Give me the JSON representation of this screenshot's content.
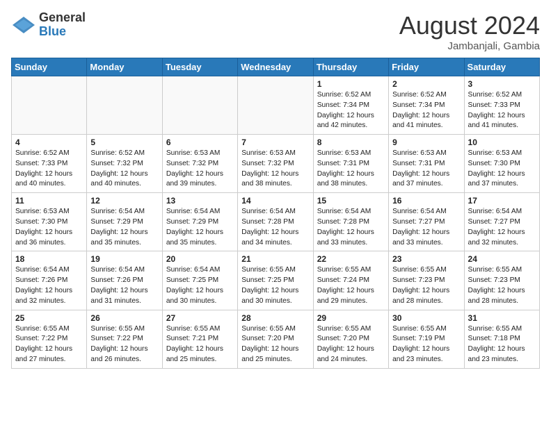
{
  "header": {
    "logo_general": "General",
    "logo_blue": "Blue",
    "title": "August 2024",
    "location": "Jambanjali, Gambia"
  },
  "days_of_week": [
    "Sunday",
    "Monday",
    "Tuesday",
    "Wednesday",
    "Thursday",
    "Friday",
    "Saturday"
  ],
  "weeks": [
    [
      {
        "day": "",
        "info": ""
      },
      {
        "day": "",
        "info": ""
      },
      {
        "day": "",
        "info": ""
      },
      {
        "day": "",
        "info": ""
      },
      {
        "day": "1",
        "info": "Sunrise: 6:52 AM\nSunset: 7:34 PM\nDaylight: 12 hours\nand 42 minutes."
      },
      {
        "day": "2",
        "info": "Sunrise: 6:52 AM\nSunset: 7:34 PM\nDaylight: 12 hours\nand 41 minutes."
      },
      {
        "day": "3",
        "info": "Sunrise: 6:52 AM\nSunset: 7:33 PM\nDaylight: 12 hours\nand 41 minutes."
      }
    ],
    [
      {
        "day": "4",
        "info": "Sunrise: 6:52 AM\nSunset: 7:33 PM\nDaylight: 12 hours\nand 40 minutes."
      },
      {
        "day": "5",
        "info": "Sunrise: 6:52 AM\nSunset: 7:32 PM\nDaylight: 12 hours\nand 40 minutes."
      },
      {
        "day": "6",
        "info": "Sunrise: 6:53 AM\nSunset: 7:32 PM\nDaylight: 12 hours\nand 39 minutes."
      },
      {
        "day": "7",
        "info": "Sunrise: 6:53 AM\nSunset: 7:32 PM\nDaylight: 12 hours\nand 38 minutes."
      },
      {
        "day": "8",
        "info": "Sunrise: 6:53 AM\nSunset: 7:31 PM\nDaylight: 12 hours\nand 38 minutes."
      },
      {
        "day": "9",
        "info": "Sunrise: 6:53 AM\nSunset: 7:31 PM\nDaylight: 12 hours\nand 37 minutes."
      },
      {
        "day": "10",
        "info": "Sunrise: 6:53 AM\nSunset: 7:30 PM\nDaylight: 12 hours\nand 37 minutes."
      }
    ],
    [
      {
        "day": "11",
        "info": "Sunrise: 6:53 AM\nSunset: 7:30 PM\nDaylight: 12 hours\nand 36 minutes."
      },
      {
        "day": "12",
        "info": "Sunrise: 6:54 AM\nSunset: 7:29 PM\nDaylight: 12 hours\nand 35 minutes."
      },
      {
        "day": "13",
        "info": "Sunrise: 6:54 AM\nSunset: 7:29 PM\nDaylight: 12 hours\nand 35 minutes."
      },
      {
        "day": "14",
        "info": "Sunrise: 6:54 AM\nSunset: 7:28 PM\nDaylight: 12 hours\nand 34 minutes."
      },
      {
        "day": "15",
        "info": "Sunrise: 6:54 AM\nSunset: 7:28 PM\nDaylight: 12 hours\nand 33 minutes."
      },
      {
        "day": "16",
        "info": "Sunrise: 6:54 AM\nSunset: 7:27 PM\nDaylight: 12 hours\nand 33 minutes."
      },
      {
        "day": "17",
        "info": "Sunrise: 6:54 AM\nSunset: 7:27 PM\nDaylight: 12 hours\nand 32 minutes."
      }
    ],
    [
      {
        "day": "18",
        "info": "Sunrise: 6:54 AM\nSunset: 7:26 PM\nDaylight: 12 hours\nand 32 minutes."
      },
      {
        "day": "19",
        "info": "Sunrise: 6:54 AM\nSunset: 7:26 PM\nDaylight: 12 hours\nand 31 minutes."
      },
      {
        "day": "20",
        "info": "Sunrise: 6:54 AM\nSunset: 7:25 PM\nDaylight: 12 hours\nand 30 minutes."
      },
      {
        "day": "21",
        "info": "Sunrise: 6:55 AM\nSunset: 7:25 PM\nDaylight: 12 hours\nand 30 minutes."
      },
      {
        "day": "22",
        "info": "Sunrise: 6:55 AM\nSunset: 7:24 PM\nDaylight: 12 hours\nand 29 minutes."
      },
      {
        "day": "23",
        "info": "Sunrise: 6:55 AM\nSunset: 7:23 PM\nDaylight: 12 hours\nand 28 minutes."
      },
      {
        "day": "24",
        "info": "Sunrise: 6:55 AM\nSunset: 7:23 PM\nDaylight: 12 hours\nand 28 minutes."
      }
    ],
    [
      {
        "day": "25",
        "info": "Sunrise: 6:55 AM\nSunset: 7:22 PM\nDaylight: 12 hours\nand 27 minutes."
      },
      {
        "day": "26",
        "info": "Sunrise: 6:55 AM\nSunset: 7:22 PM\nDaylight: 12 hours\nand 26 minutes."
      },
      {
        "day": "27",
        "info": "Sunrise: 6:55 AM\nSunset: 7:21 PM\nDaylight: 12 hours\nand 25 minutes."
      },
      {
        "day": "28",
        "info": "Sunrise: 6:55 AM\nSunset: 7:20 PM\nDaylight: 12 hours\nand 25 minutes."
      },
      {
        "day": "29",
        "info": "Sunrise: 6:55 AM\nSunset: 7:20 PM\nDaylight: 12 hours\nand 24 minutes."
      },
      {
        "day": "30",
        "info": "Sunrise: 6:55 AM\nSunset: 7:19 PM\nDaylight: 12 hours\nand 23 minutes."
      },
      {
        "day": "31",
        "info": "Sunrise: 6:55 AM\nSunset: 7:18 PM\nDaylight: 12 hours\nand 23 minutes."
      }
    ]
  ]
}
